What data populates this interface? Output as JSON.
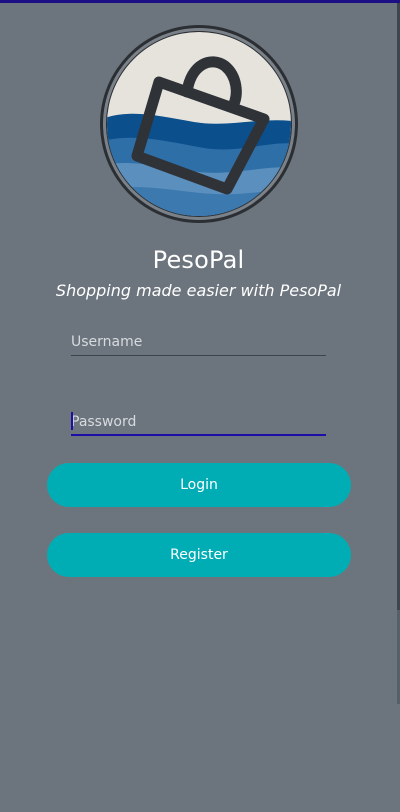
{
  "app": {
    "title": "PesoPal",
    "subtitle": "Shopping made easier with PesoPal"
  },
  "logo": {
    "icon": "shopping-bag-icon",
    "colors": {
      "ring": "#2b2f33",
      "sky": "#e6e3dd",
      "wave_dark": "#0b4f8c",
      "wave_mid": "#2f6fa8",
      "wave_light": "#5b8fbe",
      "bag_stroke": "#2f3338"
    }
  },
  "form": {
    "username": {
      "placeholder": "Username",
      "value": ""
    },
    "password": {
      "placeholder": "Password",
      "value": ""
    }
  },
  "buttons": {
    "login_label": "Login",
    "register_label": "Register"
  },
  "colors": {
    "background": "#6c757d",
    "accent": "#00adb5",
    "focus": "#1c0fa8"
  }
}
